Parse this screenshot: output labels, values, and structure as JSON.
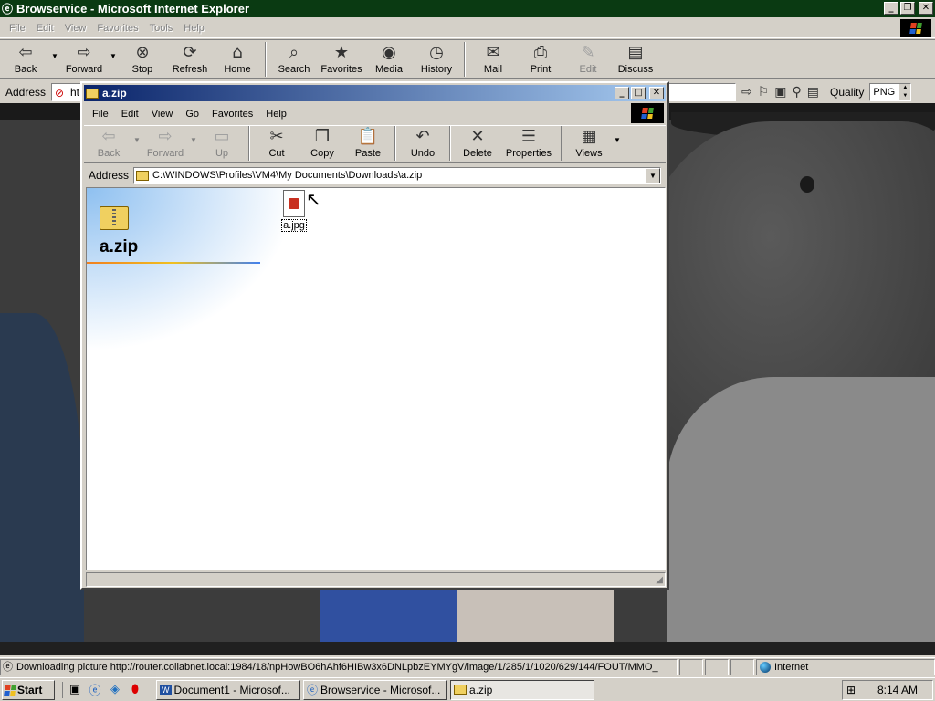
{
  "browser": {
    "title": "Browservice - Microsoft Internet Explorer",
    "menu": [
      "File",
      "Edit",
      "View",
      "Favorites",
      "Tools",
      "Help"
    ],
    "toolbar": [
      {
        "label": "Back",
        "icon": "back-arrow-icon",
        "glyph": "⇦"
      },
      {
        "label": "Forward",
        "icon": "forward-arrow-icon",
        "glyph": "⇨"
      },
      {
        "label": "Stop",
        "icon": "stop-icon",
        "glyph": "⊗"
      },
      {
        "label": "Refresh",
        "icon": "refresh-icon",
        "glyph": "⟳"
      },
      {
        "label": "Home",
        "icon": "home-icon",
        "glyph": "⌂"
      },
      {
        "label": "Search",
        "icon": "search-icon",
        "glyph": "⌕"
      },
      {
        "label": "Favorites",
        "icon": "favorites-icon",
        "glyph": "★"
      },
      {
        "label": "Media",
        "icon": "media-icon",
        "glyph": "◉"
      },
      {
        "label": "History",
        "icon": "history-icon",
        "glyph": "◷"
      },
      {
        "label": "Mail",
        "icon": "mail-icon",
        "glyph": "✉"
      },
      {
        "label": "Print",
        "icon": "print-icon",
        "glyph": "⎙"
      },
      {
        "label": "Edit",
        "icon": "edit-icon",
        "glyph": "✎"
      },
      {
        "label": "Discuss",
        "icon": "discuss-icon",
        "glyph": "▤"
      }
    ],
    "address_label": "Address",
    "address_value": "ht",
    "quality_label": "Quality",
    "quality_value": "PNG"
  },
  "explorer": {
    "title": "a.zip",
    "menu": [
      "File",
      "Edit",
      "View",
      "Go",
      "Favorites",
      "Help"
    ],
    "toolbar": [
      {
        "label": "Back",
        "glyph": "⇦"
      },
      {
        "label": "Forward",
        "glyph": "⇨"
      },
      {
        "label": "Up",
        "glyph": "▭"
      },
      {
        "label": "Cut",
        "glyph": "✂"
      },
      {
        "label": "Copy",
        "glyph": "❐"
      },
      {
        "label": "Paste",
        "glyph": "📋"
      },
      {
        "label": "Undo",
        "glyph": "↶"
      },
      {
        "label": "Delete",
        "glyph": "✕"
      },
      {
        "label": "Properties",
        "glyph": "☰"
      },
      {
        "label": "Views",
        "glyph": "▦"
      }
    ],
    "address_label": "Address",
    "address_value": "C:\\WINDOWS\\Profiles\\VM4\\My Documents\\Downloads\\a.zip",
    "folder_heading": "a.zip",
    "file_name": "a.jpg"
  },
  "status": {
    "text": "Downloading picture http://router.collabnet.local:1984/18/npHowBO6hAhf6HIBw3x6DNLpbzEYMYgV/image/1/285/1/1020/629/144/FOUT/MMO_",
    "zone": "Internet"
  },
  "taskbar": {
    "start": "Start",
    "tasks": [
      "Document1 - Microsof...",
      "Browservice - Microsof...",
      "a.zip"
    ],
    "time": "8:14 AM"
  }
}
